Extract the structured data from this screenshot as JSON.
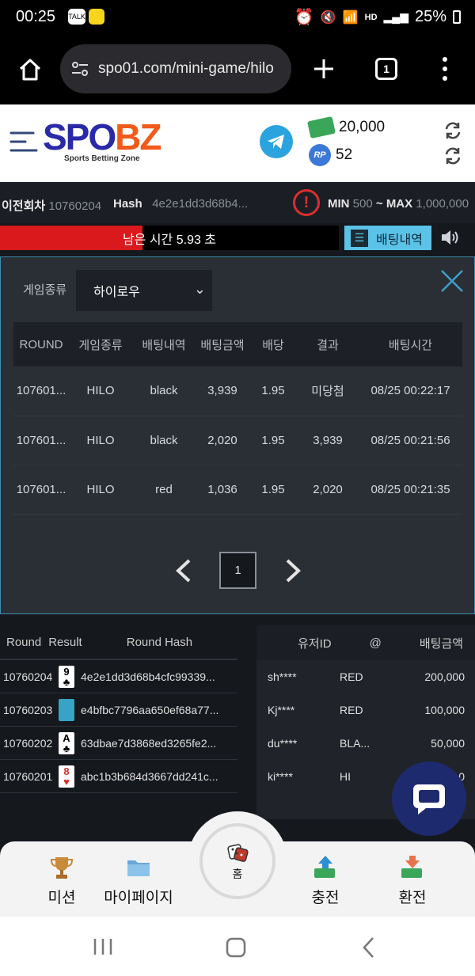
{
  "status_bar": {
    "time": "00:25",
    "battery": "25%",
    "talk_badge": "TALK",
    "hd_label": "HD"
  },
  "browser": {
    "url": "spo01.com/mini-game/hilo",
    "tab_count": "1"
  },
  "header": {
    "logo_spo": "SPO",
    "logo_bz": "BZ",
    "logo_subtitle": "Sports Betting Zone",
    "money_balance": "20,000",
    "rp_badge": "RP",
    "rp_balance": "52"
  },
  "game_info": {
    "prev_round_label": "이전회차",
    "prev_round_value": "10760204",
    "hash_label": "Hash",
    "hash_value": "4e2e1dd3d68b4...",
    "min_label": "MIN",
    "min_value": "500",
    "tilde": "~",
    "max_label": "MAX",
    "max_value": "1,000,000"
  },
  "timer": {
    "text": "남은 시간 5.93 초",
    "fill_fraction": 0.42
  },
  "history_button": {
    "label": "배팅내역"
  },
  "modal": {
    "game_type_label": "게임종류",
    "game_type_selected": "하이로우",
    "columns": [
      "ROUND",
      "게임종류",
      "배팅내역",
      "배팅금액",
      "배당",
      "결과",
      "배팅시간"
    ],
    "rows": [
      {
        "round": "107601...",
        "game": "HILO",
        "bet": "black",
        "amount": "3,939",
        "odds": "1.95",
        "result": "미당첨",
        "result_type": "lose",
        "time": "08/25 00:22:17"
      },
      {
        "round": "107601...",
        "game": "HILO",
        "bet": "black",
        "amount": "2,020",
        "odds": "1.95",
        "result": "3,939",
        "result_type": "win",
        "time": "08/25 00:21:56"
      },
      {
        "round": "107601...",
        "game": "HILO",
        "bet": "red",
        "amount": "1,036",
        "odds": "1.95",
        "result": "2,020",
        "result_type": "win",
        "time": "08/25 00:21:35"
      }
    ],
    "current_page": "1"
  },
  "rounds_panel": {
    "col_round": "Round",
    "col_result": "Result",
    "col_hash": "Round Hash",
    "rows": [
      {
        "round": "10760204",
        "card_rank": "9",
        "card_suit": "♣",
        "suit_red": false,
        "hash": "4e2e1dd3d68b4cfc99339..."
      },
      {
        "round": "10760203",
        "card_rank": "",
        "card_suit": "",
        "suit_red": false,
        "hash": "e4bfbc7796aa650ef68a77..."
      },
      {
        "round": "10760202",
        "card_rank": "A",
        "card_suit": "♣",
        "suit_red": false,
        "hash": "63dbae7d3868ed3265fe2..."
      },
      {
        "round": "10760201",
        "card_rank": "8",
        "card_suit": "♥",
        "suit_red": true,
        "hash": "abc1b3b684d3667dd241c..."
      }
    ]
  },
  "users_panel": {
    "col_user": "유저ID",
    "col_at": "@",
    "col_amount": "배팅금액",
    "rows": [
      {
        "user": "sh****",
        "pick": "RED",
        "amount": "200,000"
      },
      {
        "user": "Kj****",
        "pick": "RED",
        "amount": "100,000"
      },
      {
        "user": "du****",
        "pick": "BLA...",
        "amount": "50,000"
      },
      {
        "user": "ki****",
        "pick": "HI",
        "amount": "0"
      }
    ]
  },
  "bottom_nav": {
    "mission": "미션",
    "mypage": "마이페이지",
    "home": "홈",
    "deposit": "충전",
    "withdraw": "환전"
  }
}
